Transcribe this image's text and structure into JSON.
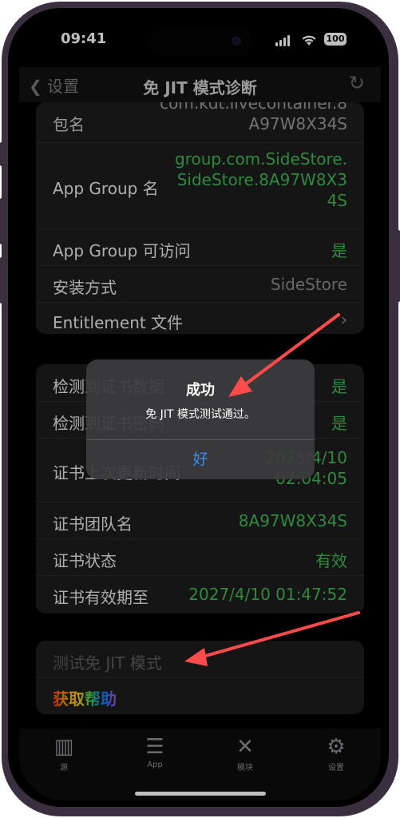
{
  "status": {
    "time": "09:41",
    "battery": "100"
  },
  "nav": {
    "back_label": "设置",
    "title": "免 JIT 模式诊断"
  },
  "group1": {
    "rows": [
      {
        "label": "包名",
        "value": "com.kdt.livecontainer.8A97W8X34S"
      },
      {
        "label": "App Group 名",
        "value": "group.com.SideStore.SideStore.8A97W8X34S"
      },
      {
        "label": "App Group 可访问",
        "value": "是"
      },
      {
        "label": "安装方式",
        "value": "SideStore"
      },
      {
        "label": "Entitlement 文件",
        "value": ""
      }
    ]
  },
  "group2": {
    "rows": [
      {
        "label": "检测到证书数据",
        "value": "是"
      },
      {
        "label": "检测到证书密码",
        "value": "是"
      },
      {
        "label": "证书上次更新时间",
        "value": "2025/4/10 02:04:05"
      },
      {
        "label": "证书团队名",
        "value": "8A97W8X34S"
      },
      {
        "label": "证书状态",
        "value": "有效"
      },
      {
        "label": "证书有效期至",
        "value": "2027/4/10 01:47:52"
      }
    ]
  },
  "group3": {
    "test_label": "测试免 JIT 模式",
    "help_label": "获取帮助"
  },
  "tabs": [
    {
      "label": "源",
      "icon": "books-icon"
    },
    {
      "label": "App",
      "icon": "stack-icon"
    },
    {
      "label": "模块",
      "icon": "tools-icon"
    },
    {
      "label": "设置",
      "icon": "gear-icon"
    }
  ],
  "alert": {
    "title": "成功",
    "message": "免 JIT 模式测试通过。",
    "ok_label": "好"
  },
  "colors": {
    "accent_green": "#3fb950",
    "accent_blue": "#3a8ef6",
    "arrow_red": "#ff4b4b"
  }
}
